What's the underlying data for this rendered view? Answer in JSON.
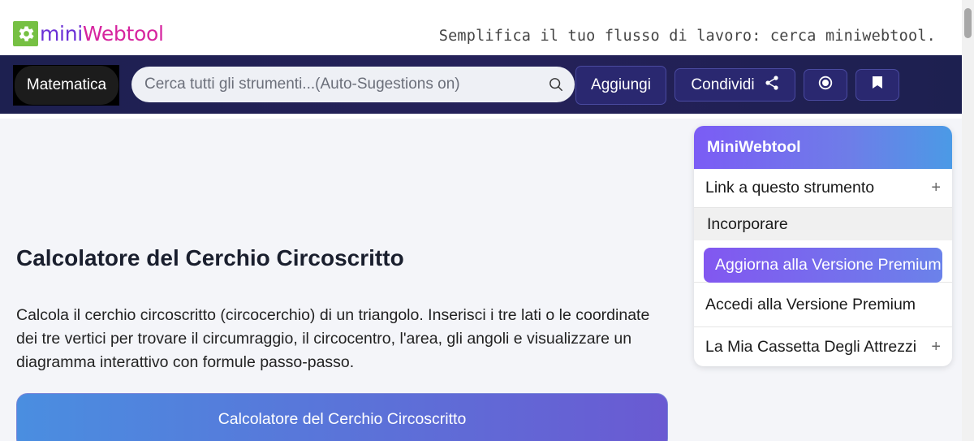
{
  "header": {
    "logo": {
      "mini": "mini",
      "web": "Webtool",
      "icon": "gear-icon"
    },
    "tagline": "Semplifica il tuo flusso di lavoro: cerca miniwebtool."
  },
  "navbar": {
    "category_label": "Matematica",
    "search": {
      "placeholder": "Cerca tutti gli strumenti...(Auto-Sugestions on)",
      "value": "",
      "icon": "search-icon"
    },
    "add_label": "Aggiungi",
    "share_label": "Condividi",
    "share_icon": "share-icon",
    "record_icon": "record-icon",
    "bookmark_icon": "bookmark-icon"
  },
  "main": {
    "title": "Calcolatore del Cerchio Circoscritto",
    "intro": "Calcola il cerchio circoscritto (circocerchio) di un triangolo. Inserisci i tre lati o le coordinate dei tre vertici per trovare il circumraggio, il circocentro, l'area, gli angoli e visualizzare un diagramma interattivo con formule passo-passo.",
    "calculator_title": "Calcolatore del Cerchio Circoscritto"
  },
  "sidebar": {
    "title": "MiniWebtool",
    "items": [
      {
        "label": "Link a questo strumento",
        "expand": "+"
      },
      {
        "label": "Incorporare"
      },
      {
        "label": "Aggiorna alla Versione Premium"
      },
      {
        "label": "Accedi alla Versione Premium"
      },
      {
        "label": "La Mia Cassetta Degli Attrezzi",
        "expand": "+"
      }
    ]
  },
  "colors": {
    "navbar_bg": "#1d2050",
    "button_bg": "#2a2870",
    "logo_green": "#76c043",
    "logo_purple": "#6b2fd6",
    "logo_pink": "#d6249f",
    "premium_gradient_start": "#8257f0",
    "premium_gradient_end": "#6b82ea"
  }
}
